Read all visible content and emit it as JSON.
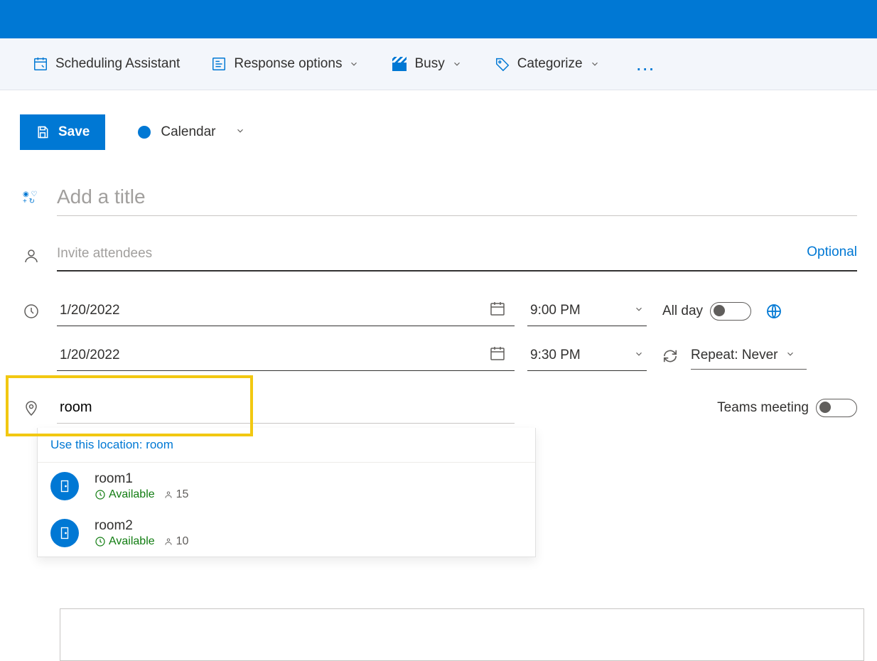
{
  "toolbar": {
    "scheduling": "Scheduling Assistant",
    "response": "Response options",
    "busy": "Busy",
    "categorize": "Categorize"
  },
  "actions": {
    "save": "Save",
    "calendar_selected": "Calendar"
  },
  "form": {
    "title_placeholder": "Add a title",
    "attendees_placeholder": "Invite attendees",
    "optional_label": "Optional",
    "start_date": "1/20/2022",
    "start_time": "9:00 PM",
    "end_date": "1/20/2022",
    "end_time": "9:30 PM",
    "all_day_label": "All day",
    "repeat_prefix": "Repeat:",
    "repeat_value": "Never",
    "location_value": "room",
    "teams_label": "Teams meeting"
  },
  "suggestions": {
    "use_prefix": "Use this location: ",
    "use_value": "room",
    "available_label": "Available",
    "items": [
      {
        "name": "room1",
        "available": true,
        "capacity": "15"
      },
      {
        "name": "room2",
        "available": true,
        "capacity": "10"
      }
    ]
  }
}
